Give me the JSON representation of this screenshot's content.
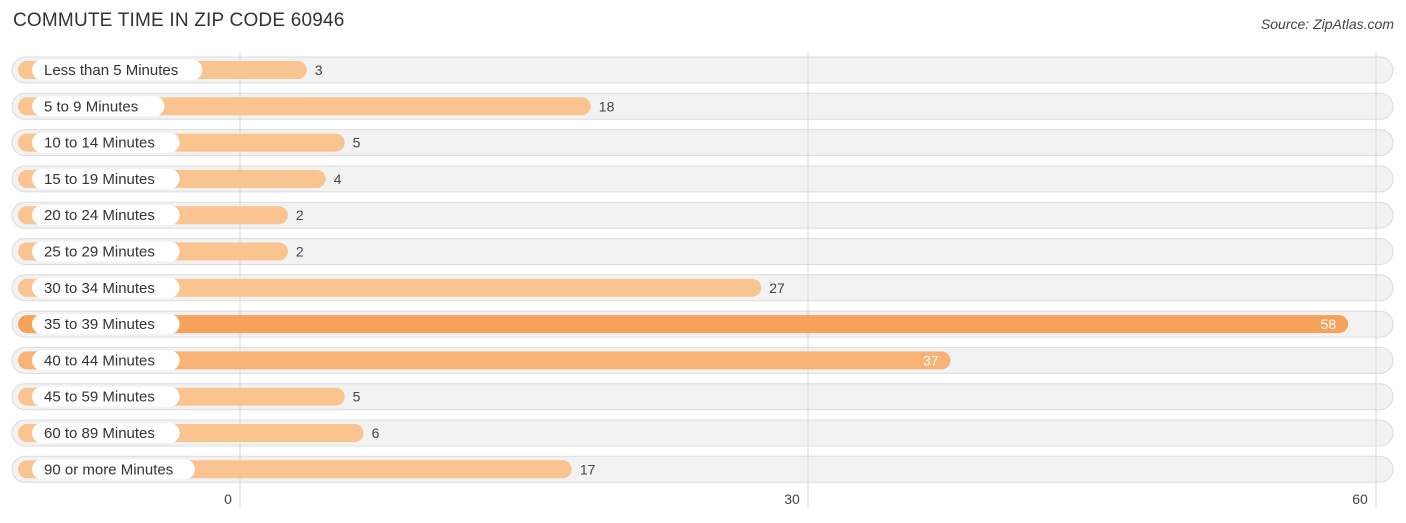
{
  "header": {
    "title": "COMMUTE TIME IN ZIP CODE 60946",
    "source": "Source: ZipAtlas.com"
  },
  "chart_data": {
    "type": "bar",
    "orientation": "horizontal",
    "title": "COMMUTE TIME IN ZIP CODE 60946",
    "xlabel": "",
    "ylabel": "",
    "categories": [
      "Less than 5 Minutes",
      "5 to 9 Minutes",
      "10 to 14 Minutes",
      "15 to 19 Minutes",
      "20 to 24 Minutes",
      "25 to 29 Minutes",
      "30 to 34 Minutes",
      "35 to 39 Minutes",
      "40 to 44 Minutes",
      "45 to 59 Minutes",
      "60 to 89 Minutes",
      "90 or more Minutes"
    ],
    "values": [
      3,
      18,
      5,
      4,
      2,
      2,
      27,
      58,
      37,
      5,
      6,
      17
    ],
    "xlim": [
      0,
      60
    ],
    "xticks": [
      0,
      30,
      60
    ],
    "grid": true,
    "colors": {
      "light_bar": "#f9c490",
      "strong_bar": "#f5a35a",
      "mid_bar": "#f7b275",
      "value_inside": "#ffffff",
      "value_outside": "#444444"
    }
  }
}
